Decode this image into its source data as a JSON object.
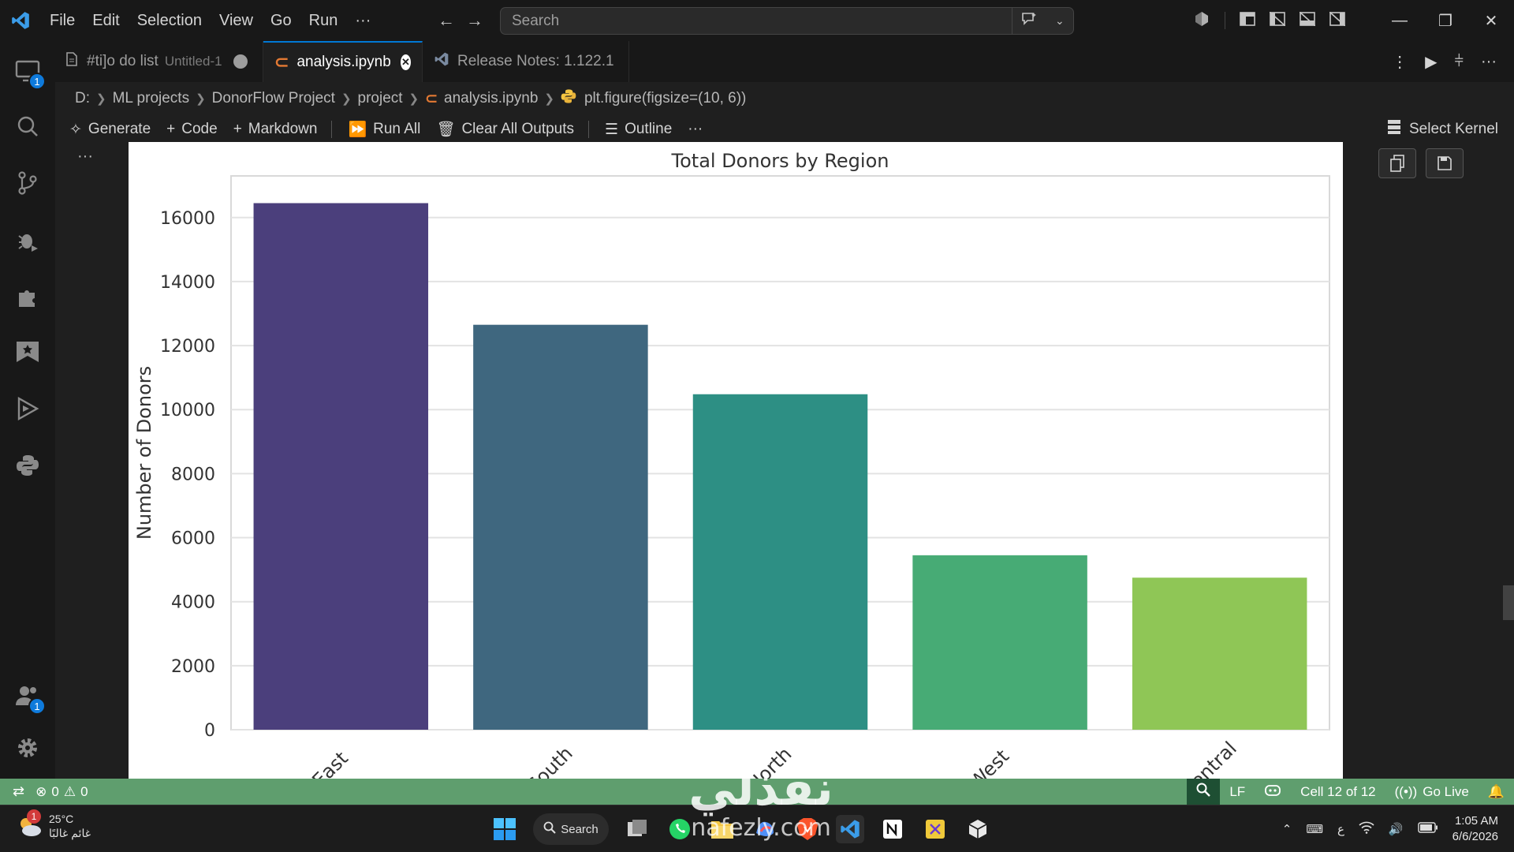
{
  "menu": [
    "File",
    "Edit",
    "Selection",
    "View",
    "Go",
    "Run",
    "···"
  ],
  "search": {
    "placeholder": "Search"
  },
  "tabs": [
    {
      "label": "#ti]o do list",
      "sub": "Untitled-1"
    },
    {
      "label": "analysis.ipynb"
    },
    {
      "label": "Release Notes: 1.122.1"
    }
  ],
  "breadcrumb": [
    "D:",
    "ML projects",
    "DonorFlow Project",
    "project",
    "analysis.ipynb",
    "plt.figure(figsize=(10, 6))"
  ],
  "toolbar": {
    "generate": "Generate",
    "code": "Code",
    "markdown": "Markdown",
    "run_all": "Run All",
    "clear_outputs": "Clear All Outputs",
    "outline": "Outline",
    "more": "···",
    "kernel": "Select Kernel"
  },
  "activity_badges": {
    "remote": "1",
    "accounts": "1"
  },
  "chart_data": {
    "type": "bar",
    "title": "Total Donors by Region",
    "xlabel": "",
    "ylabel": "Number of Donors",
    "categories": [
      "East",
      "South",
      "North",
      "West",
      "Central"
    ],
    "values": [
      16450,
      12650,
      10480,
      5450,
      4750
    ],
    "ylim": [
      0,
      17300
    ],
    "yticks": [
      0,
      2000,
      4000,
      6000,
      8000,
      10000,
      12000,
      14000,
      16000
    ],
    "colors": [
      "#4b3f7c",
      "#3f677f",
      "#2d8f84",
      "#47ab75",
      "#8fc656"
    ],
    "grid": true
  },
  "status": {
    "errors": "0",
    "warnings": "0",
    "eol": "LF",
    "cell": "Cell 12 of 12",
    "go_live": "Go Live"
  },
  "taskbar": {
    "temperature": "25°C",
    "weather_desc": "غائم غالبًا",
    "search_label": "Search",
    "keyboard_lang": "ع",
    "time": "1:05 AM",
    "date": "6/6/2026",
    "weather_badge": "1"
  },
  "watermark": {
    "big": "نفذلي",
    "small": "nafezly.com"
  }
}
